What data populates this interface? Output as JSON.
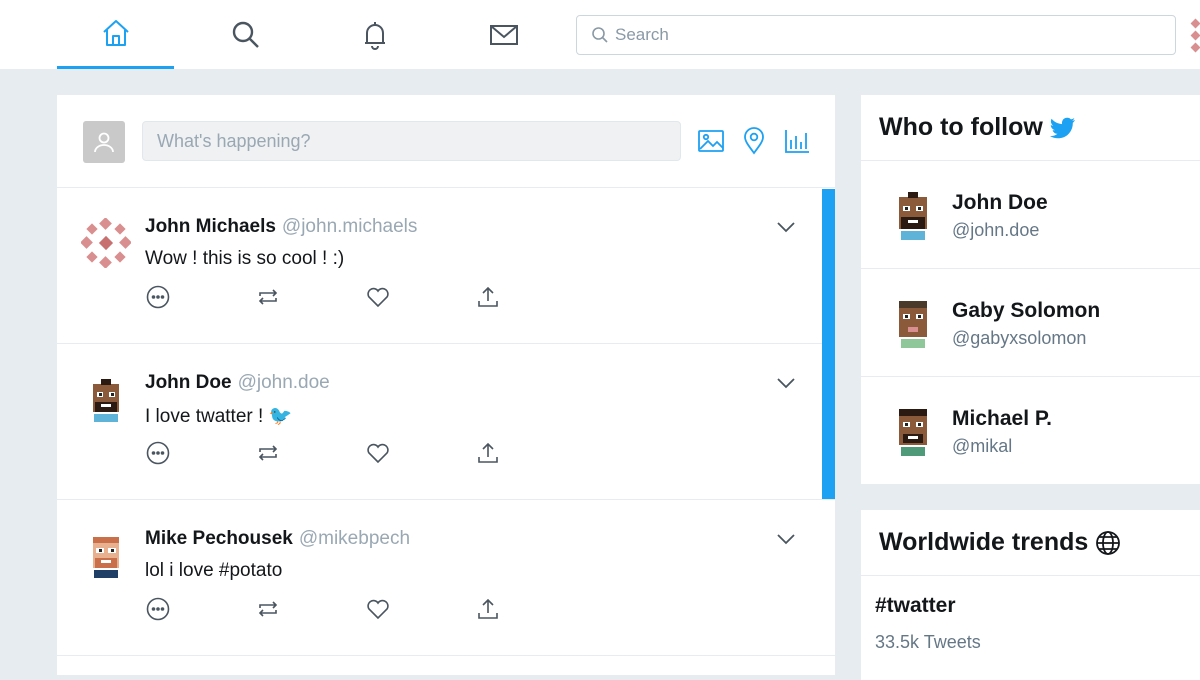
{
  "nav": {
    "items": [
      {
        "id": "home",
        "icon": "home-icon",
        "active": true
      },
      {
        "id": "explore",
        "icon": "search-icon",
        "active": false
      },
      {
        "id": "notifications",
        "icon": "bell-icon",
        "active": false
      },
      {
        "id": "messages",
        "icon": "mail-icon",
        "active": false
      }
    ],
    "search_placeholder": "Search"
  },
  "composer": {
    "placeholder": "What's happening?",
    "tools": [
      "image-icon",
      "location-icon",
      "poll-icon"
    ]
  },
  "tweets": [
    {
      "name": "John Michaels",
      "handle": "@john.michaels",
      "text": "Wow ! this is so cool ! :)",
      "avatar": "pattern-avatar"
    },
    {
      "name": "John Doe",
      "handle": "@john.doe",
      "text": "I love twatter ! 🐦",
      "avatar": "pixel-avatar"
    },
    {
      "name": "Mike Pechousek",
      "handle": "@mikebpech",
      "text": "lol i love #potato",
      "avatar": "pixel-avatar"
    }
  ],
  "who_to_follow": {
    "title": "Who to follow",
    "users": [
      {
        "name": "John Doe",
        "handle": "@john.doe"
      },
      {
        "name": "Gaby Solomon",
        "handle": "@gabyxsolomon"
      },
      {
        "name": "Michael P.",
        "handle": "@mikal"
      }
    ]
  },
  "trends": {
    "title": "Worldwide trends",
    "items": [
      {
        "tag": "#twatter",
        "count": "33.5k Tweets"
      }
    ]
  },
  "colors": {
    "accent": "#1da1f2",
    "background": "#e6ecf0",
    "muted": "#657786"
  }
}
